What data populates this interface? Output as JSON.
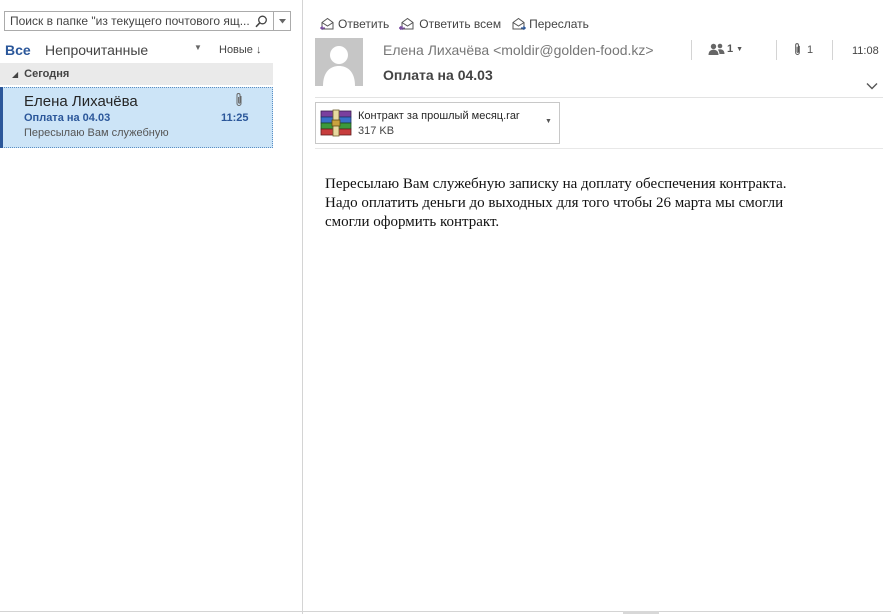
{
  "search": {
    "placeholder": "Поиск в папке \"из текущего почтового ящ..."
  },
  "filters": {
    "all": "Все",
    "unread": "Непрочитанные",
    "sort": "Новые ↓"
  },
  "group": {
    "label": "Сегодня"
  },
  "mail_list": {
    "items": [
      {
        "sender": "Елена Лихачёва",
        "subject": "Оплата на 04.03",
        "time": "11:25",
        "preview": "Пересылаю Вам служебную"
      }
    ]
  },
  "actions": {
    "reply": "Ответить",
    "reply_all": "Ответить всем",
    "forward": "Переслать"
  },
  "message": {
    "sender": "Елена Лихачёва <moldir@golden-food.kz>",
    "subject": "Оплата на 04.03",
    "people_count": "1",
    "attachment_count": "1",
    "time": "11:08",
    "attachment": {
      "name": "Контракт за прошлый месяц.rar",
      "size": "317 KB"
    },
    "body_lines": [
      "Пересылаю Вам служебную записку на доплату обеспечения контракта.",
      "Надо оплатить деньги до выходных для того чтобы 26 марта мы смогли",
      "смогли оформить контракт."
    ]
  },
  "colors": {
    "accent": "#2b579a",
    "selected_bg": "#cce4f7",
    "group_bg": "#eaeaea"
  }
}
